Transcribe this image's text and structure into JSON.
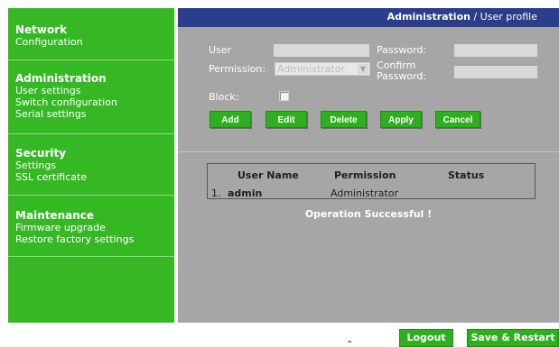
{
  "sidebar": {
    "network": {
      "title": "Network",
      "items": [
        "Configuration"
      ]
    },
    "administration": {
      "title": "Administration",
      "items": [
        "User settings",
        "Switch configuration",
        "Serial settings"
      ]
    },
    "security": {
      "title": "Security",
      "items": [
        "Settings",
        "SSL certificate"
      ]
    },
    "maintenance": {
      "title": "Maintenance",
      "items": [
        "Firmware upgrade",
        "Restore factory settings"
      ]
    }
  },
  "header": {
    "section": "Administration",
    "separator": " / ",
    "page": "User profile"
  },
  "form": {
    "user_label": "User",
    "user_value": "",
    "password_label": "Password:",
    "password_value": "",
    "permission_label": "Permission:",
    "permission_value": "Administrator",
    "confirm_label_line1": "Confirm",
    "confirm_label_line2": "Password:",
    "confirm_value": "",
    "block_label": "Block:",
    "block_checked": false
  },
  "buttons": {
    "add": "Add",
    "edit": "Edit",
    "delete": "Delete",
    "apply": "Apply",
    "cancel": "Cancel"
  },
  "table": {
    "headers": [
      "User Name",
      "Permission",
      "Status"
    ],
    "rows": [
      {
        "index": "1.",
        "user": "admin",
        "permission": "Administrator",
        "status": ""
      }
    ]
  },
  "message": "Operation Successful !",
  "footer": {
    "logout": "Logout",
    "save_restart": "Save & Restart"
  },
  "colors": {
    "sidebar_green": "#35b824",
    "header_blue": "#2a3e8c",
    "panel_gray": "#a6a6a6",
    "button_green": "#2fae1f"
  }
}
